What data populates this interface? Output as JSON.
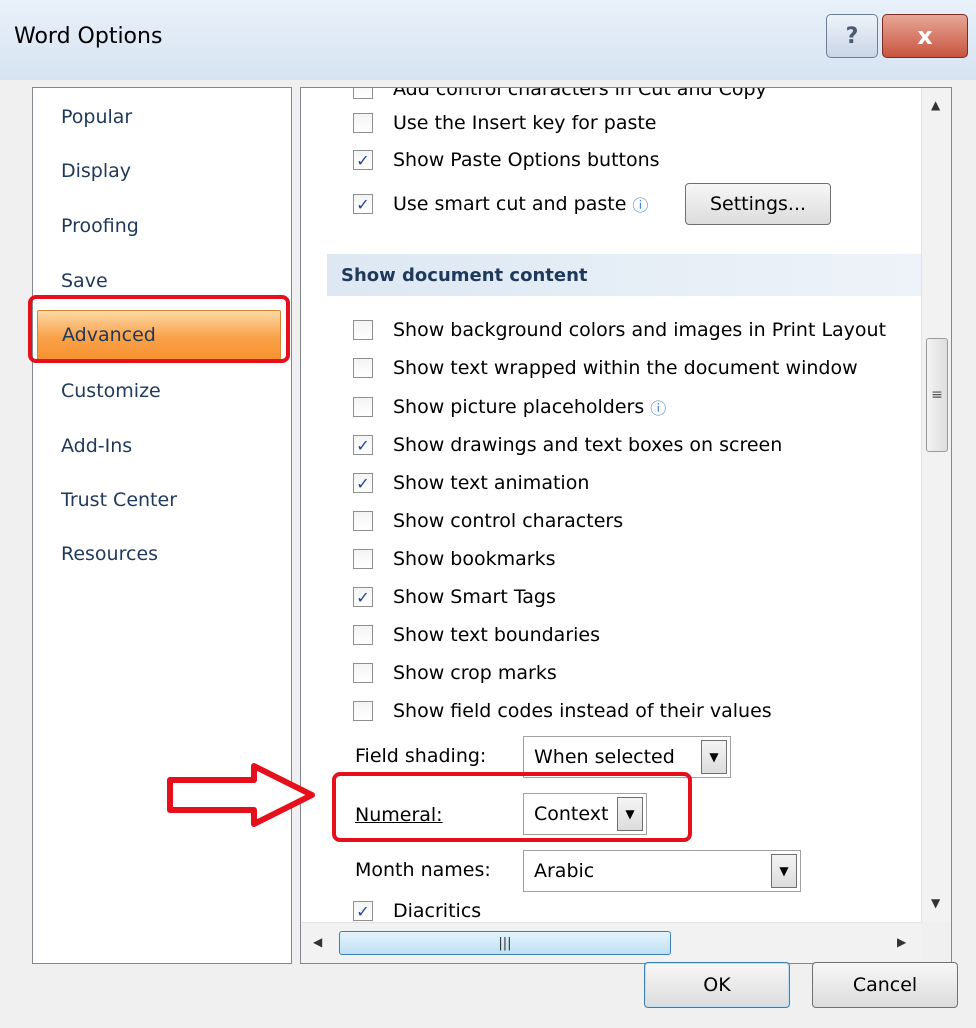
{
  "window": {
    "title": "Word Options",
    "help_glyph": "?",
    "close_glyph": "x"
  },
  "nav": {
    "items": [
      {
        "label": "Popular"
      },
      {
        "label": "Display"
      },
      {
        "label": "Proofing"
      },
      {
        "label": "Save"
      },
      {
        "label": "Advanced",
        "selected": true
      },
      {
        "label": "Customize"
      },
      {
        "label": "Add-Ins"
      },
      {
        "label": "Trust Center"
      },
      {
        "label": "Resources"
      }
    ]
  },
  "cut_copy_paste": {
    "partial_top_label": "Add control characters in Cut and Copy",
    "insert_key": {
      "label": "Use the Insert key for paste",
      "checked": false
    },
    "paste_options": {
      "label": "Show Paste Options buttons",
      "checked": true
    },
    "smart_cut": {
      "label": "Use smart cut and paste",
      "checked": true
    },
    "settings_button": "Settings..."
  },
  "show_document_content": {
    "header": "Show document content",
    "options": [
      {
        "label": "Show background colors and images in Print Layout",
        "checked": false
      },
      {
        "label": "Show text wrapped within the document window",
        "checked": false
      },
      {
        "label": "Show picture placeholders",
        "checked": false
      },
      {
        "label": "Show drawings and text boxes on screen",
        "checked": true
      },
      {
        "label": "Show text animation",
        "checked": true
      },
      {
        "label": "Show control characters",
        "checked": false
      },
      {
        "label": "Show bookmarks",
        "checked": false
      },
      {
        "label": "Show Smart Tags",
        "checked": true
      },
      {
        "label": "Show text boundaries",
        "checked": false
      },
      {
        "label": "Show crop marks",
        "checked": false
      },
      {
        "label": "Show field codes instead of their values",
        "checked": false
      }
    ],
    "field_shading": {
      "label": "Field shading:",
      "value": "When selected"
    },
    "numeral": {
      "label": "Numeral:",
      "value": "Context"
    },
    "month_names": {
      "label": "Month names:",
      "value": "Arabic"
    },
    "diacritics": {
      "label": "Diacritics",
      "checked": true
    }
  },
  "footer": {
    "ok_label": "OK",
    "cancel_label": "Cancel"
  },
  "colors": {
    "highlight": "#e60f1c",
    "selected_nav": "#f7932f",
    "section_header": "#1e395b"
  },
  "icons": [
    "help-icon",
    "close-icon",
    "info-icon",
    "chevron-down-icon",
    "arrow-right-icon"
  ]
}
